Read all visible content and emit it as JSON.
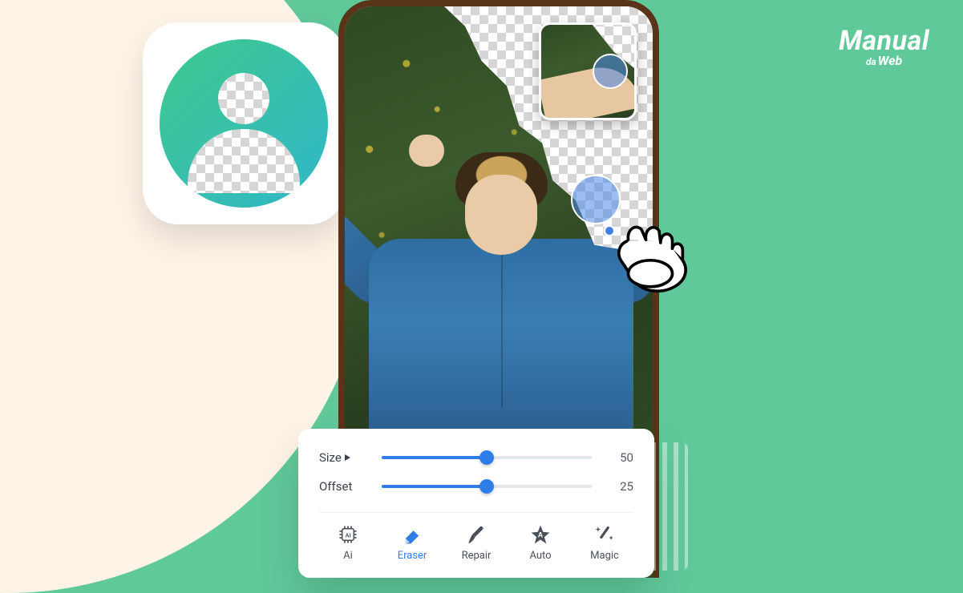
{
  "brand": {
    "main": "Manual",
    "sub_small": "da",
    "sub_big": "Web"
  },
  "sliders": {
    "size": {
      "label": "Size",
      "value": 50,
      "min": 0,
      "max": 100
    },
    "offset": {
      "label": "Offset",
      "value": 25,
      "min": 0,
      "max": 50
    }
  },
  "tools": {
    "ai": {
      "label": "Ai",
      "active": false
    },
    "eraser": {
      "label": "Eraser",
      "active": true
    },
    "repair": {
      "label": "Repair",
      "active": false
    },
    "auto": {
      "label": "Auto",
      "active": false
    },
    "magic": {
      "label": "Magic",
      "active": false
    }
  },
  "colors": {
    "background": "#60c99a",
    "cream": "#fdf3e7",
    "accent": "#2f7de9",
    "phone_frame": "#5a3419"
  }
}
